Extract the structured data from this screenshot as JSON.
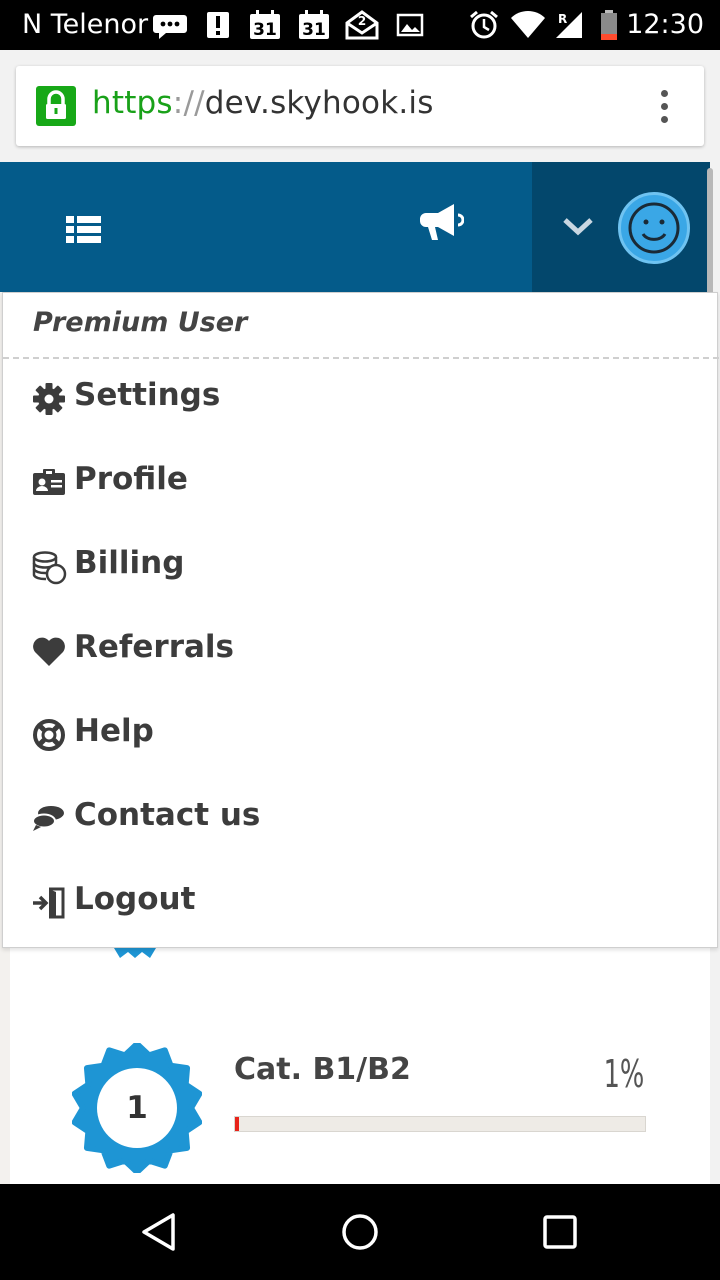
{
  "status_bar": {
    "carrier": "N Telenor",
    "calendar_day_1": "31",
    "calendar_day_2": "31",
    "mail_badge": "2",
    "signal_roaming": "R",
    "time": "12:30",
    "icons": [
      "message-icon",
      "alert-icon",
      "calendar-icon",
      "calendar-icon",
      "mail-icon",
      "image-icon",
      "alarm-icon",
      "wifi-icon",
      "signal-icon",
      "battery-icon"
    ]
  },
  "browser": {
    "url_scheme": "https",
    "url_separator": "://",
    "url_host": "dev.skyhook.is",
    "lock_color": "#17a817"
  },
  "topnav": {
    "background": "#045b8a",
    "icons": [
      "list-icon",
      "megaphone-icon",
      "chevron-down-icon",
      "avatar"
    ]
  },
  "user_menu": {
    "header": "Premium User",
    "items": [
      {
        "label": "Settings",
        "icon": "gear-icon"
      },
      {
        "label": "Profile",
        "icon": "id-card-icon"
      },
      {
        "label": "Billing",
        "icon": "coins-icon"
      },
      {
        "label": "Referrals",
        "icon": "heart-icon"
      },
      {
        "label": "Help",
        "icon": "life-ring-icon"
      },
      {
        "label": "Contact us",
        "icon": "chat-icon"
      },
      {
        "label": "Logout",
        "icon": "sign-out-icon"
      }
    ]
  },
  "content": {
    "level": {
      "badge_number": "1",
      "category": "Cat. B1/B2",
      "percent_text": "1%",
      "progress_fraction": 0.01,
      "progress_color": "#e8231a",
      "badge_color": "#1e95d4"
    }
  },
  "android_nav": {
    "buttons": [
      "back-icon",
      "home-icon",
      "recents-icon"
    ]
  }
}
